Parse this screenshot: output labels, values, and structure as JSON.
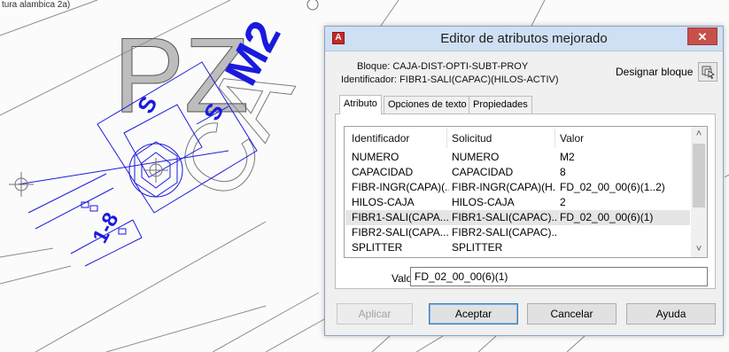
{
  "cad": {
    "corner_text": "tura alambica 2a)",
    "text_pz": "PZ",
    "text_m2": "M2",
    "text_s1": "S",
    "text_s2": "S",
    "text_18": "1-8",
    "text_ca": "CA"
  },
  "dialog": {
    "title": "Editor de atributos mejorado",
    "close_symbol": "✕",
    "block_label": "Bloque: CAJA-DIST-OPTI-SUBT-PROY",
    "identifier_label": "Identificador: FIBR1-SALI(CAPAC)(HILOS-ACTIV)",
    "designate_label": "Designar bloque",
    "tabs": [
      {
        "label": "Atributo"
      },
      {
        "label": "Opciones de texto"
      },
      {
        "label": "Propiedades"
      }
    ],
    "list": {
      "headers": [
        "Identificador",
        "Solicitud",
        "Valor"
      ],
      "rows": [
        [
          "NUMERO",
          "NUMERO",
          "M2"
        ],
        [
          "CAPACIDAD",
          "CAPACIDAD",
          "8"
        ],
        [
          "FIBR-INGR(CAPA)(...",
          "FIBR-INGR(CAPA)(H...",
          "FD_02_00_00(6)(1..2)"
        ],
        [
          "HILOS-CAJA",
          "HILOS-CAJA",
          "2"
        ],
        [
          "FIBR1-SALI(CAPA...",
          "FIBR1-SALI(CAPAC)...",
          "FD_02_00_00(6)(1)"
        ],
        [
          "FIBR2-SALI(CAPA...",
          "FIBR2-SALI(CAPAC)...",
          ""
        ],
        [
          "SPLITTER",
          "SPLITTER",
          ""
        ]
      ],
      "selected_index": 4,
      "scroll_up": "˄",
      "scroll_down": "˅"
    },
    "value_label": "Valor:",
    "value_text": "FD_02_00_00(6)(1)",
    "buttons": {
      "apply": "Aplicar",
      "accept": "Aceptar",
      "cancel": "Cancelar",
      "help": "Ayuda"
    },
    "colors": {
      "cad_blue": "#1a1adf",
      "cad_gray": "#6f6f6f",
      "title_bar": "#cfe0f4"
    }
  }
}
